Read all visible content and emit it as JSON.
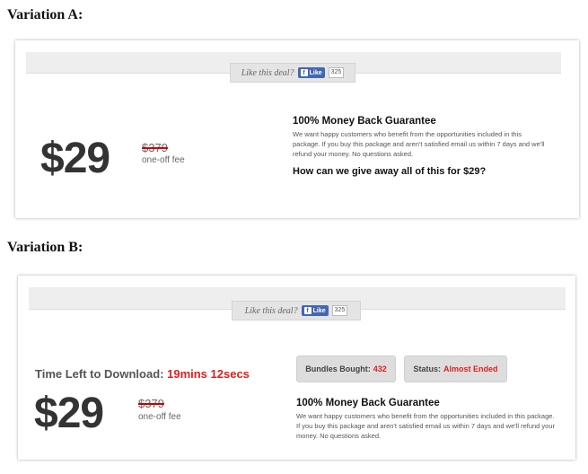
{
  "variation_a": {
    "heading": "Variation A:",
    "like": {
      "text": "Like this deal?",
      "button": "Like",
      "count": "325"
    },
    "price": "$29",
    "old_price": "$379",
    "fee": "one-off fee",
    "guarantee_title": "100% Money Back Guarantee",
    "guarantee_text": "We want happy customers who benefit from the opportunities included in this package. If you buy this package and aren't satisfied email us within 7 days and we'll refund your money. No questions asked.",
    "question": "How can we give away all of this for $29?"
  },
  "variation_b": {
    "heading": "Variation B:",
    "like": {
      "text": "Like this deal?",
      "button": "Like",
      "count": "325"
    },
    "timer_label": "Time Left to Download:",
    "timer_value": "19mins 12secs",
    "bundles_label": "Bundles Bought:",
    "bundles_value": "432",
    "status_label": "Status:",
    "status_value": "Almost Ended",
    "price": "$29",
    "old_price": "$379",
    "fee": "one-off fee",
    "guarantee_title": "100% Money Back Guarantee",
    "guarantee_text": "We want happy customers who benefit from the opportunities included in this package. If you buy this package and aren't satisfied email us within 7 days and we'll refund your money. No questions asked."
  },
  "icons": {
    "facebook": "facebook-f-icon"
  },
  "colors": {
    "accent_red": "#e0201f",
    "facebook_blue": "#4267b2"
  }
}
